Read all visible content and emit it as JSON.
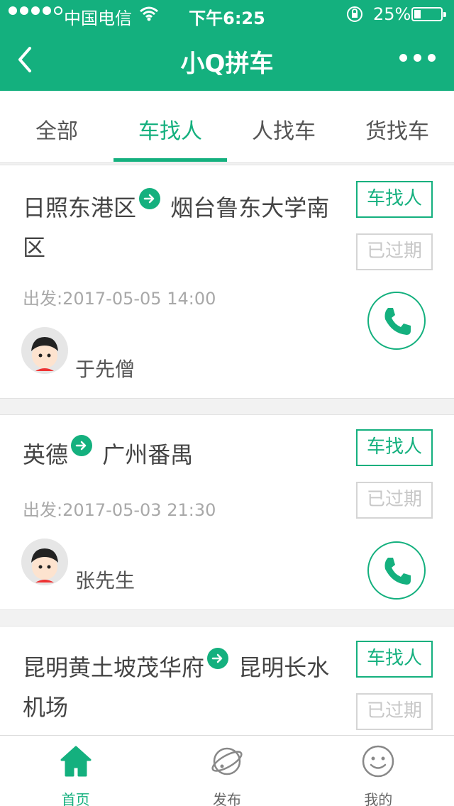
{
  "status_bar": {
    "carrier": "中国电信",
    "time": "下午6:25",
    "battery": "25%"
  },
  "navbar": {
    "title": "小Q拼车"
  },
  "tabs": [
    {
      "label": "全部",
      "active": false
    },
    {
      "label": "车找人",
      "active": true
    },
    {
      "label": "人找车",
      "active": false
    },
    {
      "label": "货找车",
      "active": false
    }
  ],
  "cards": [
    {
      "route_from": "日照东港区",
      "route_to": "烟台鲁东大学南区",
      "type_tag": "车找人",
      "status_tag": "已过期",
      "departure": "出发:2017-05-05 14:00",
      "user_name": "于先僧"
    },
    {
      "route_from": "英德",
      "route_to": "广州番禺",
      "type_tag": "车找人",
      "status_tag": "已过期",
      "departure": "出发:2017-05-03 21:30",
      "user_name": "张先生"
    },
    {
      "route_from": "昆明黄土坡茂华府",
      "route_to": "昆明长水机场",
      "type_tag": "车找人",
      "status_tag": "已过期"
    }
  ],
  "bottom_nav": [
    {
      "label": "首页",
      "icon": "home-icon",
      "active": true
    },
    {
      "label": "发布",
      "icon": "planet-icon",
      "active": false
    },
    {
      "label": "我的",
      "icon": "smiley-icon",
      "active": false
    }
  ],
  "colors": {
    "accent": "#14b07e",
    "expired": "#c8c8c8"
  }
}
